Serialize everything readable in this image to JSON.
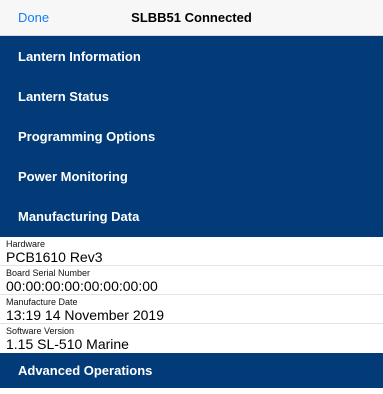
{
  "nav": {
    "done_label": "Done",
    "title": "SLBB51 Connected"
  },
  "sections": [
    {
      "label": "Lantern Information"
    },
    {
      "label": "Lantern Status"
    },
    {
      "label": "Programming Options"
    },
    {
      "label": "Power Monitoring"
    },
    {
      "label": "Manufacturing Data"
    }
  ],
  "manufacturing_rows": [
    {
      "label": "Hardware",
      "value": "PCB1610 Rev3"
    },
    {
      "label": "Board Serial Number",
      "value": "00:00:00:00:00:00:00:00"
    },
    {
      "label": "Manufacture Date",
      "value": "13:19 14 November 2019"
    },
    {
      "label": "Software Version",
      "value": "1.15 SL-510 Marine"
    }
  ],
  "advanced": {
    "label": "Advanced Operations"
  },
  "colors": {
    "section_bg": "#023b78",
    "accent": "#1a7cf5"
  }
}
